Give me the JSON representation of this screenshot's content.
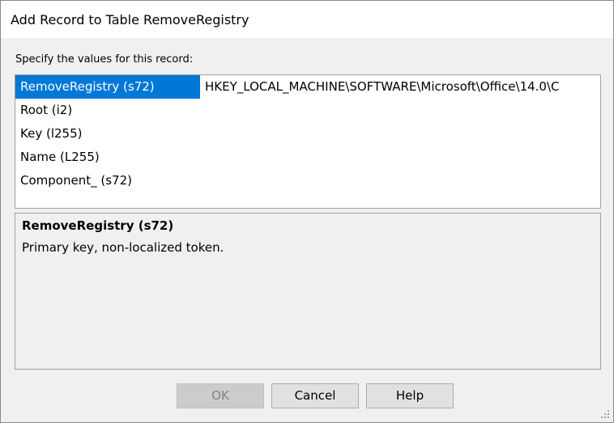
{
  "window": {
    "title": "Add Record to Table RemoveRegistry"
  },
  "form": {
    "prompt": "Specify the values for this record:"
  },
  "fields": [
    {
      "name": "RemoveRegistry (s72)",
      "value": "HKEY_LOCAL_MACHINE\\SOFTWARE\\Microsoft\\Office\\14.0\\C",
      "selected": true
    },
    {
      "name": "Root (i2)",
      "value": ""
    },
    {
      "name": "Key (l255)",
      "value": ""
    },
    {
      "name": "Name (L255)",
      "value": ""
    },
    {
      "name": "Component_ (s72)",
      "value": ""
    }
  ],
  "description": {
    "title": "RemoveRegistry (s72)",
    "text": "Primary key, non-localized token."
  },
  "buttons": {
    "ok": "OK",
    "cancel": "Cancel",
    "help": "Help"
  },
  "colors": {
    "selection": "#0078d7",
    "dialog_background": "#f0f0f0"
  }
}
